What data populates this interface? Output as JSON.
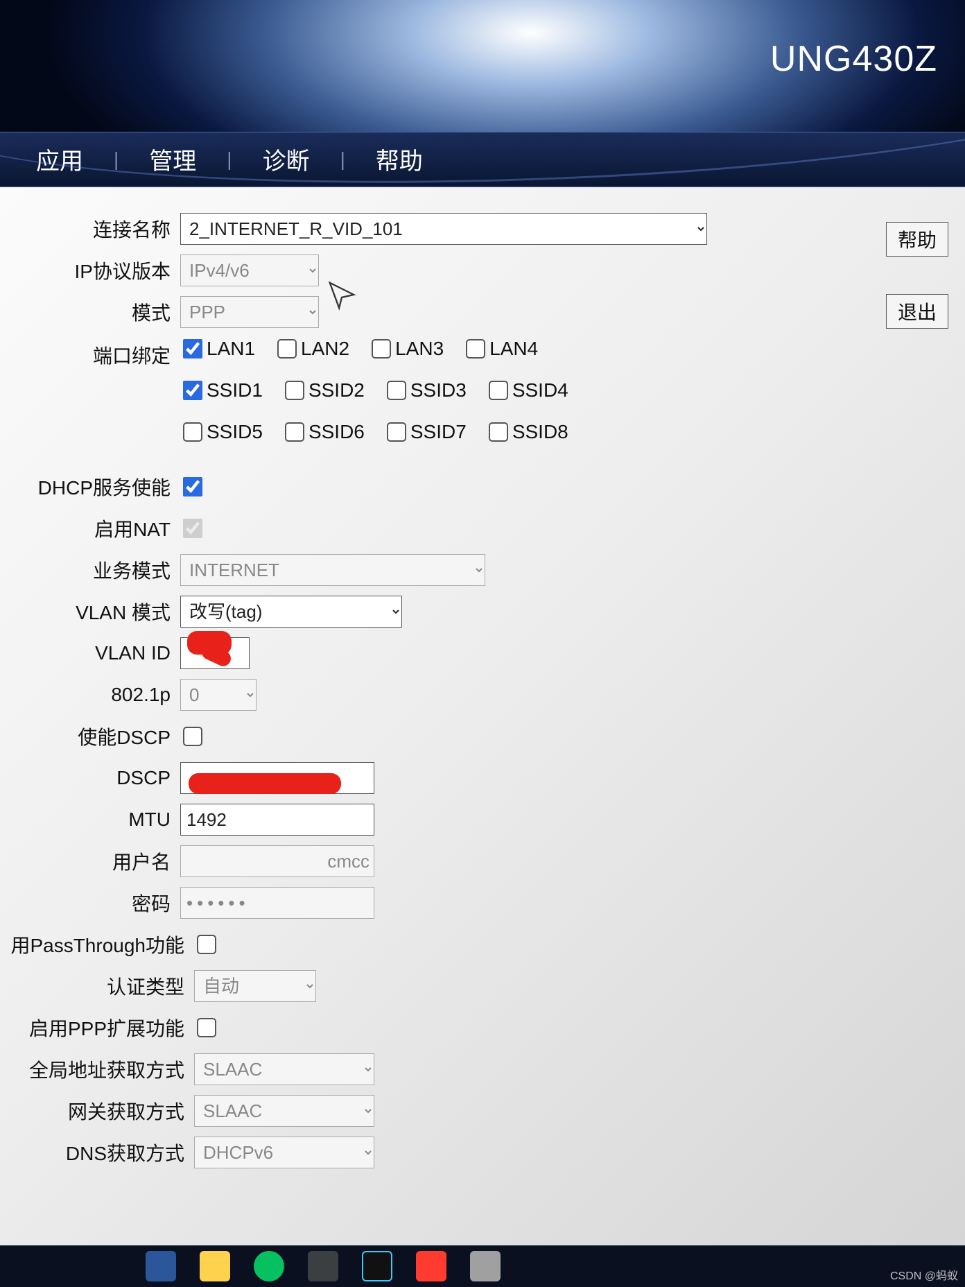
{
  "model": "UNG430Z",
  "nav": {
    "app": "应用",
    "mgmt": "管理",
    "diag": "诊断",
    "help": "帮助"
  },
  "side": {
    "help": "帮助",
    "exit": "退出"
  },
  "form": {
    "conn_name_lbl": "连接名称",
    "conn_name": "2_INTERNET_R_VID_101",
    "ip_ver_lbl": "IP协议版本",
    "ip_ver": "IPv4/v6",
    "mode_lbl": "模式",
    "mode": "PPP",
    "port_bind_lbl": "端口绑定",
    "ports": [
      {
        "id": "lan1",
        "label": "LAN1",
        "checked": true
      },
      {
        "id": "lan2",
        "label": "LAN2",
        "checked": false
      },
      {
        "id": "lan3",
        "label": "LAN3",
        "checked": false
      },
      {
        "id": "lan4",
        "label": "LAN4",
        "checked": false
      },
      {
        "id": "ssid1",
        "label": "SSID1",
        "checked": true
      },
      {
        "id": "ssid2",
        "label": "SSID2",
        "checked": false
      },
      {
        "id": "ssid3",
        "label": "SSID3",
        "checked": false
      },
      {
        "id": "ssid4",
        "label": "SSID4",
        "checked": false
      },
      {
        "id": "ssid5",
        "label": "SSID5",
        "checked": false
      },
      {
        "id": "ssid6",
        "label": "SSID6",
        "checked": false
      },
      {
        "id": "ssid7",
        "label": "SSID7",
        "checked": false
      },
      {
        "id": "ssid8",
        "label": "SSID8",
        "checked": false
      }
    ],
    "dhcp_lbl": "DHCP服务使能",
    "dhcp_checked": true,
    "nat_lbl": "启用NAT",
    "nat_checked": true,
    "nat_disabled": true,
    "svc_lbl": "业务模式",
    "svc": "INTERNET",
    "vlan_mode_lbl": "VLAN 模式",
    "vlan_mode": "改写(tag)",
    "vlan_id_lbl": "VLAN ID",
    "vlan_id": "",
    "p8021_lbl": "802.1p",
    "p8021": "0",
    "dscp_en_lbl": "使能DSCP",
    "dscp_lbl": "DSCP",
    "dscp": "",
    "mtu_lbl": "MTU",
    "mtu": "1492",
    "user_lbl": "用户名",
    "user_suffix": "cmcc",
    "pwd_lbl": "密码",
    "pwd": "••••••",
    "pt_lbl": "用PassThrough功能",
    "auth_lbl": "认证类型",
    "auth": "自动",
    "ppp_ext_lbl": "启用PPP扩展功能",
    "global_lbl": "全局地址获取方式",
    "global": "SLAAC",
    "gw_lbl": "网关获取方式",
    "gw": "SLAAC",
    "dns_lbl": "DNS获取方式",
    "dns": "DHCPv6"
  },
  "watermark": "CSDN @蚂蚁"
}
